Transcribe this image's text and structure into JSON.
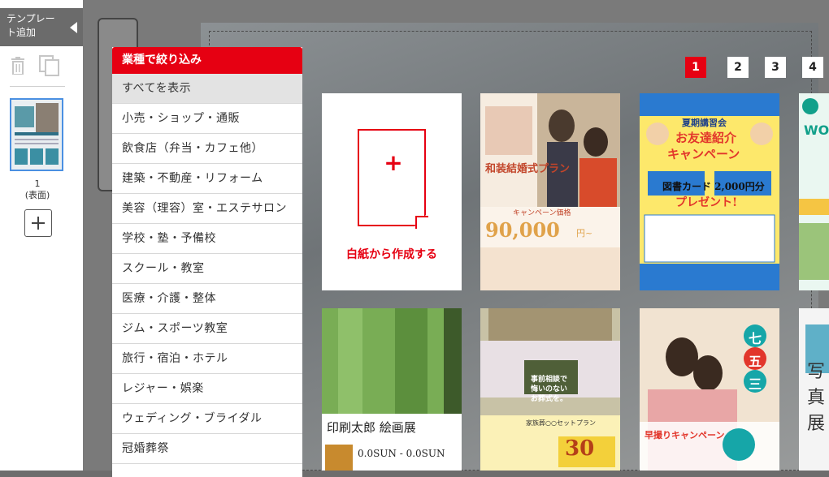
{
  "rail": {
    "tab_label": "テンプレート追加",
    "page_number": "1",
    "page_side": "(表面)"
  },
  "filter": {
    "header": "業種で絞り込み",
    "items": [
      "すべてを表示",
      "小売・ショップ・通販",
      "飲食店（弁当・カフェ他）",
      "建築・不動産・リフォーム",
      "美容（理容）室・エステサロン",
      "学校・塾・予備校",
      "スクール・教室",
      "医療・介護・整体",
      "ジム・スポーツ教室",
      "旅行・宿泊・ホテル",
      "レジャー・娯楽",
      "ウェディング・ブライダル",
      "冠婚葬祭"
    ],
    "selected_index": 0
  },
  "pagination": {
    "pages": [
      "1",
      "2",
      "3",
      "4"
    ],
    "active": "1"
  },
  "templates": {
    "blank_label": "白紙から作成する",
    "blank_plus": "+",
    "wedding": {
      "title": "和装結婚式プラン",
      "price": "90,000",
      "price_unit": "円~",
      "campaign": "キャンペーン価格"
    },
    "summer": {
      "top": "夏期講習会",
      "headline1": "お友達紹介",
      "headline2": "キャンペーン",
      "gift": "図書カード 2,000円分",
      "present": "プレゼント!"
    },
    "wo": {
      "text": "WO"
    },
    "art": {
      "title": "印刷太郎 絵画展",
      "dates": "0.0SUN - 0.0SUN"
    },
    "funeral": {
      "line1": "事前相談で",
      "line2": "悔いのない",
      "line3": "お葬式を。",
      "price": "30",
      "plan": "家族葬○○セットプラン"
    },
    "shichigosan": {
      "c1": "七",
      "c2": "五",
      "c3": "三",
      "campaign": "早撮りキャンペーン"
    },
    "photo": {
      "c1": "写",
      "c2": "真",
      "c3": "展"
    }
  },
  "colors": {
    "accent": "#e60012",
    "thumb_border": "#4a90e2",
    "overlay": "#6d6d6d"
  },
  "icons": [
    "trash-icon",
    "copy-icon",
    "chevron-left-icon",
    "plus-icon"
  ]
}
